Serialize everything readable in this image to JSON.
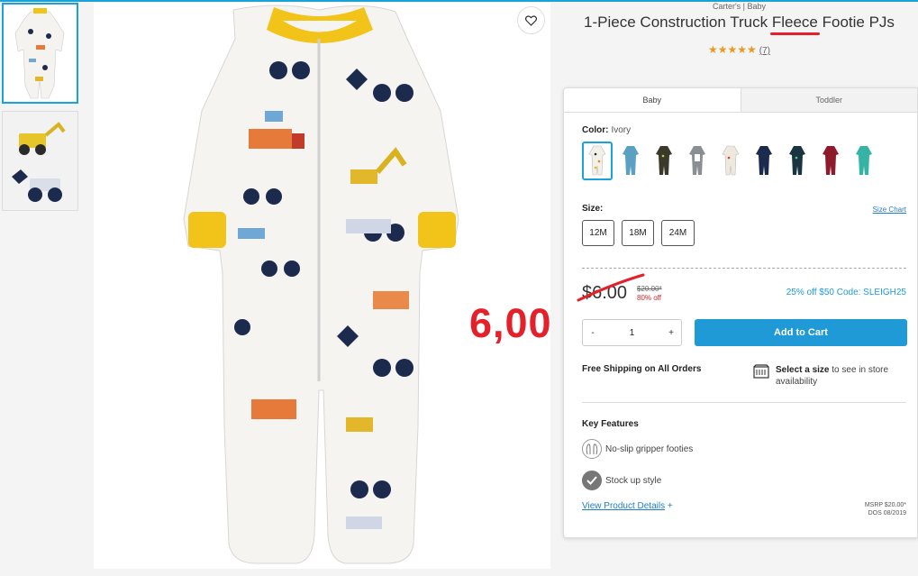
{
  "product": {
    "brand": "Carter's | Baby",
    "title_before": "1-Piece Construction Truck ",
    "title_highlight": "Fleece",
    "title_after": " Footie PJs",
    "stars": "★★★★★",
    "review_count": "(7)"
  },
  "tabs": [
    {
      "label": "Baby"
    },
    {
      "label": "Toddler"
    }
  ],
  "color": {
    "label": "Color:",
    "selected": "Ivory",
    "swatches": [
      "#f3f0e8",
      "#5aa0c2",
      "#3a3a2a",
      "#8a8f93",
      "#efe8df",
      "#1c2a4e",
      "#1b3441",
      "#8e1b2c",
      "#35b3a5"
    ]
  },
  "size": {
    "label": "Size:",
    "chart_link": "Size Chart",
    "options": [
      "12M",
      "18M",
      "24M"
    ]
  },
  "price": {
    "current": "$6.00",
    "original": "$20.00*",
    "discount": "80% off",
    "promo": "25% off $50 Code: SLEIGH25"
  },
  "quantity": {
    "minus": "-",
    "value": "1",
    "plus": "+"
  },
  "add_to_cart": "Add to Cart",
  "shipping": {
    "free": "Free Shipping on All Orders",
    "store_bold": "Select a size",
    "store_rest": " to see in store availability"
  },
  "features": {
    "title": "Key Features",
    "items": [
      "No-slip gripper footies",
      "Stock up style"
    ]
  },
  "details_link": "View Product Details",
  "details_plus": "+",
  "msrp": "MSRP $20.00*",
  "dos": "DOS 08/2019",
  "annotation": "6,00",
  "colors": {
    "accent": "#19a3d8",
    "cart": "#1f9ad6",
    "sale_red": "#e4202a",
    "star": "#e89a23"
  }
}
